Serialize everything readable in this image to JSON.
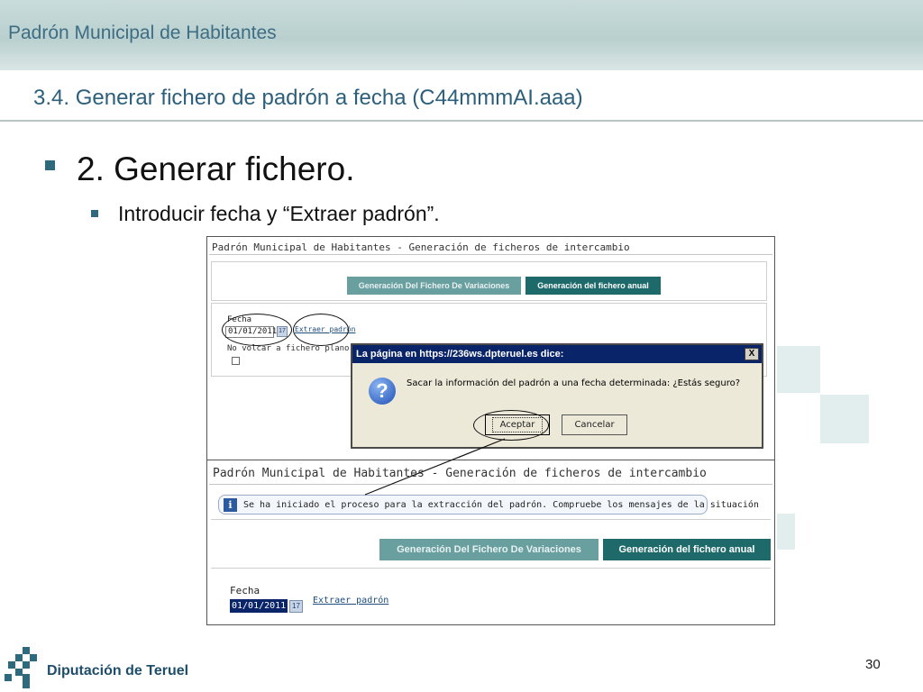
{
  "header": {
    "title": "Padrón Municipal de Habitantes"
  },
  "section": {
    "title": "3.4. Generar fichero de padrón a fecha (C44mmmAI.aaa)"
  },
  "bullets": {
    "level1": "2. Generar fichero.",
    "level2": "Introducir fecha y “Extraer padrón”."
  },
  "screenshot1": {
    "window_title": "Padrón Municipal de Habitantes - Generación de ficheros de intercambio",
    "tab_variaciones": "Generación Del Fichero De Variaciones",
    "tab_anual": "Generación del fichero anual",
    "fecha_label": "Fecha",
    "fecha_value": "01/01/2011",
    "calendar_glyph": "17",
    "extraer_link": "Extraer padrón",
    "no_volcar_label": "No volcar a fichero plano"
  },
  "dialog": {
    "title": "La página en https://236ws.dpteruel.es dice:",
    "close_glyph": "X",
    "icon_glyph": "?",
    "message": "Sacar la información del padrón a una fecha determinada: ¿Estás seguro?",
    "accept_label": "Aceptar",
    "cancel_label": "Cancelar"
  },
  "screenshot2": {
    "window_title": "Padrón Municipal de Habitantes - Generación de ficheros de intercambio",
    "info_glyph": "i",
    "info_message": "Se ha iniciado el proceso para la extracción del padrón. Compruebe los mensajes de la situación",
    "tab_variaciones": "Generación Del Fichero De Variaciones",
    "tab_anual": "Generación del fichero anual",
    "fecha_label": "Fecha",
    "fecha_value": "01/01/2011",
    "calendar_glyph": "17",
    "extraer_link": "Extraer padrón"
  },
  "footer": {
    "organization": "Diputación de Teruel",
    "page_number": "30"
  },
  "colors": {
    "accent": "#2c5f7c",
    "tab_active": "#1e6a6b",
    "tab_inactive": "#6a9fa0",
    "dialog_titlebar": "#0a246a"
  }
}
